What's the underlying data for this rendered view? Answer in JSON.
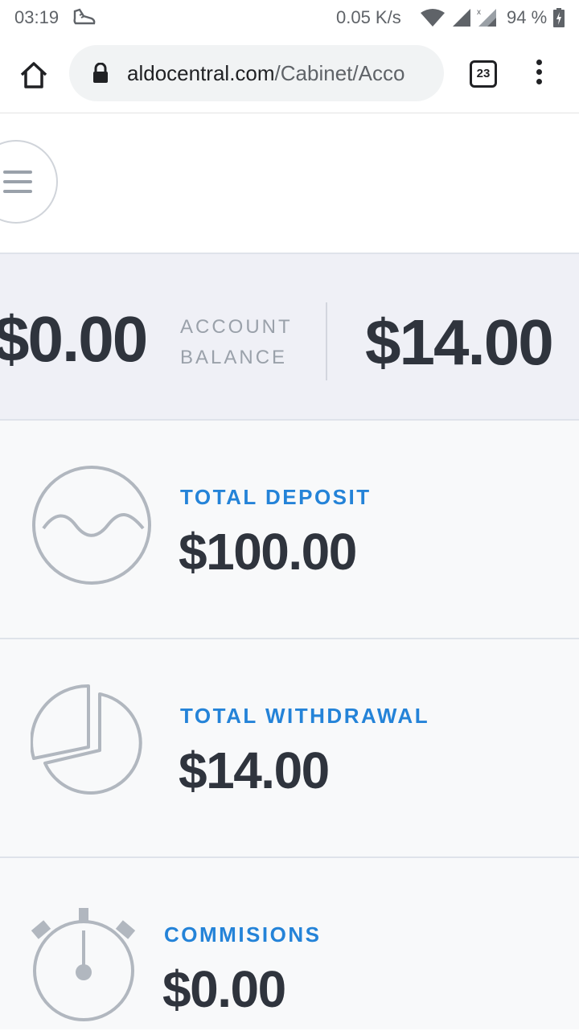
{
  "status_bar": {
    "time": "03:19",
    "net_speed": "0.05 K/s",
    "battery": "94 %"
  },
  "browser": {
    "url_domain": "aldocentral.com",
    "url_path": "/Cabinet/Acco",
    "tab_count": "23"
  },
  "balance": {
    "left_amount": "$0.00",
    "label_line1": "ACCOUNT",
    "label_line2": "BALANCE",
    "right_amount": "$14.00"
  },
  "stats": [
    {
      "label": "TOTAL DEPOSIT",
      "value": "$100.00",
      "icon": "wave-icon"
    },
    {
      "label": "TOTAL WITHDRAWAL",
      "value": "$14.00",
      "icon": "pie-chart-icon"
    },
    {
      "label": "COMMISIONS",
      "value": "$0.00",
      "icon": "stopwatch-icon"
    }
  ],
  "colors": {
    "accent": "#2483d8",
    "text_dark": "#2f343d",
    "muted": "#9aa1aa",
    "band_bg": "#eff0f6",
    "card_bg": "#f8f9fa"
  }
}
